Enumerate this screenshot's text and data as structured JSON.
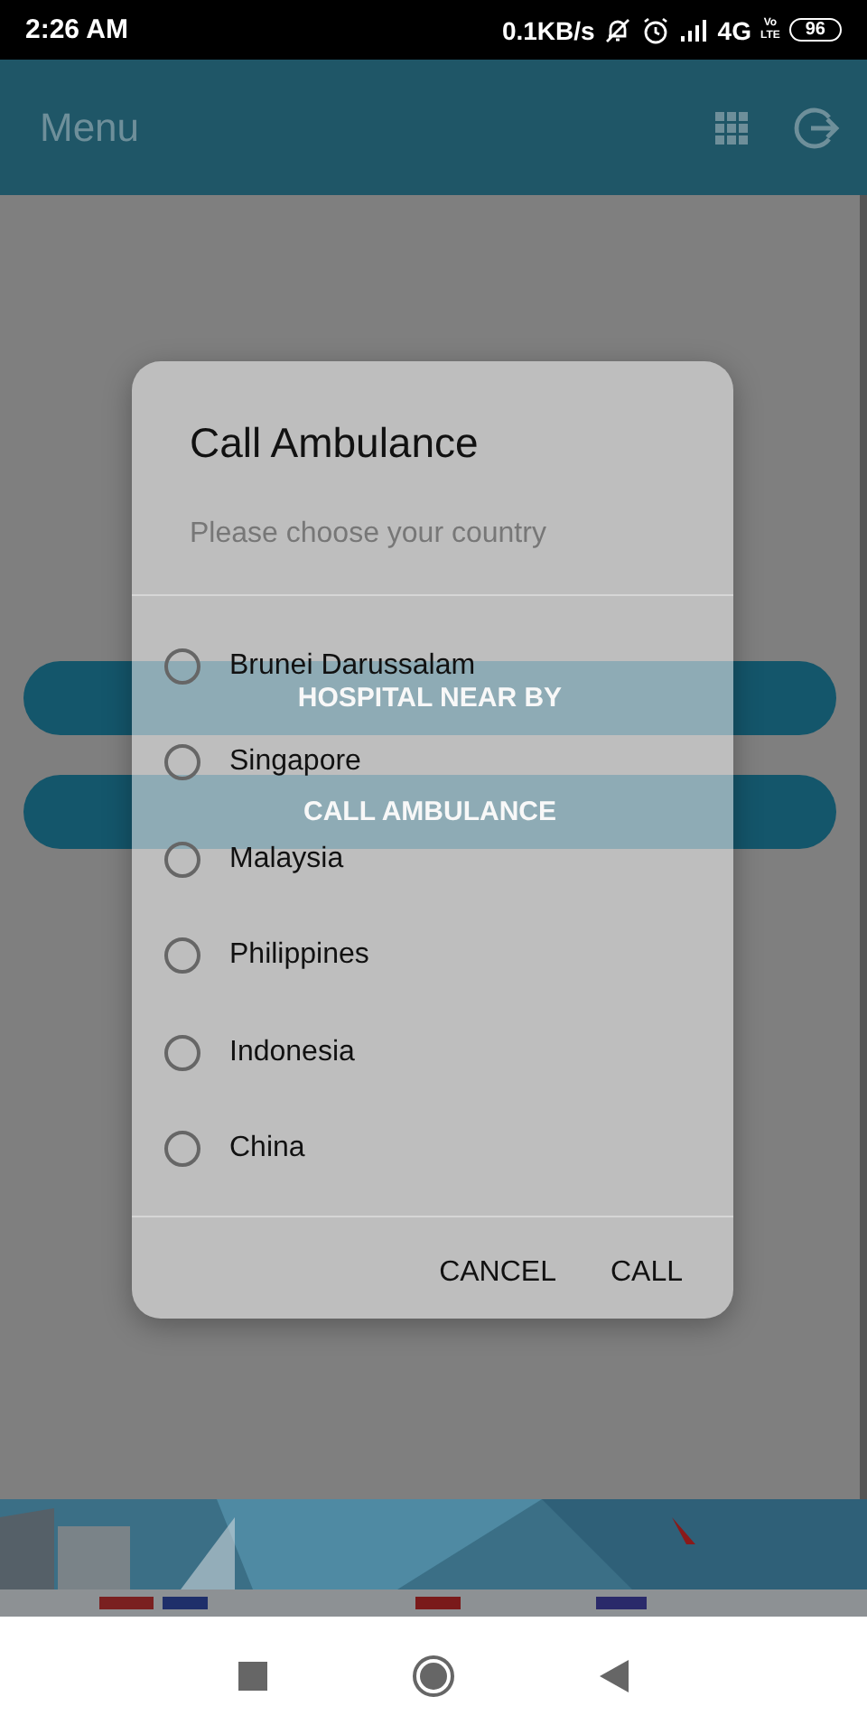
{
  "status_bar": {
    "time": "2:26 AM",
    "speed": "0.1KB/s",
    "network": "4G",
    "volte": [
      "Vo",
      "LTE"
    ],
    "battery": "96"
  },
  "app_bar": {
    "title": "Menu"
  },
  "buttons": [
    "HOSPITAL NEAR BY",
    "CALL AMBULANCE"
  ],
  "dialog": {
    "title": "Call Ambulance",
    "subtitle": "Please choose your country",
    "options": [
      {
        "label": "Brunei Darussalam",
        "selected": false
      },
      {
        "label": "Singapore",
        "selected": false
      },
      {
        "label": "Malaysia",
        "selected": false
      },
      {
        "label": "Philippines",
        "selected": false
      },
      {
        "label": "Indonesia",
        "selected": false
      },
      {
        "label": "China",
        "selected": false
      }
    ],
    "actions": [
      "CANCEL",
      "CALL"
    ]
  }
}
